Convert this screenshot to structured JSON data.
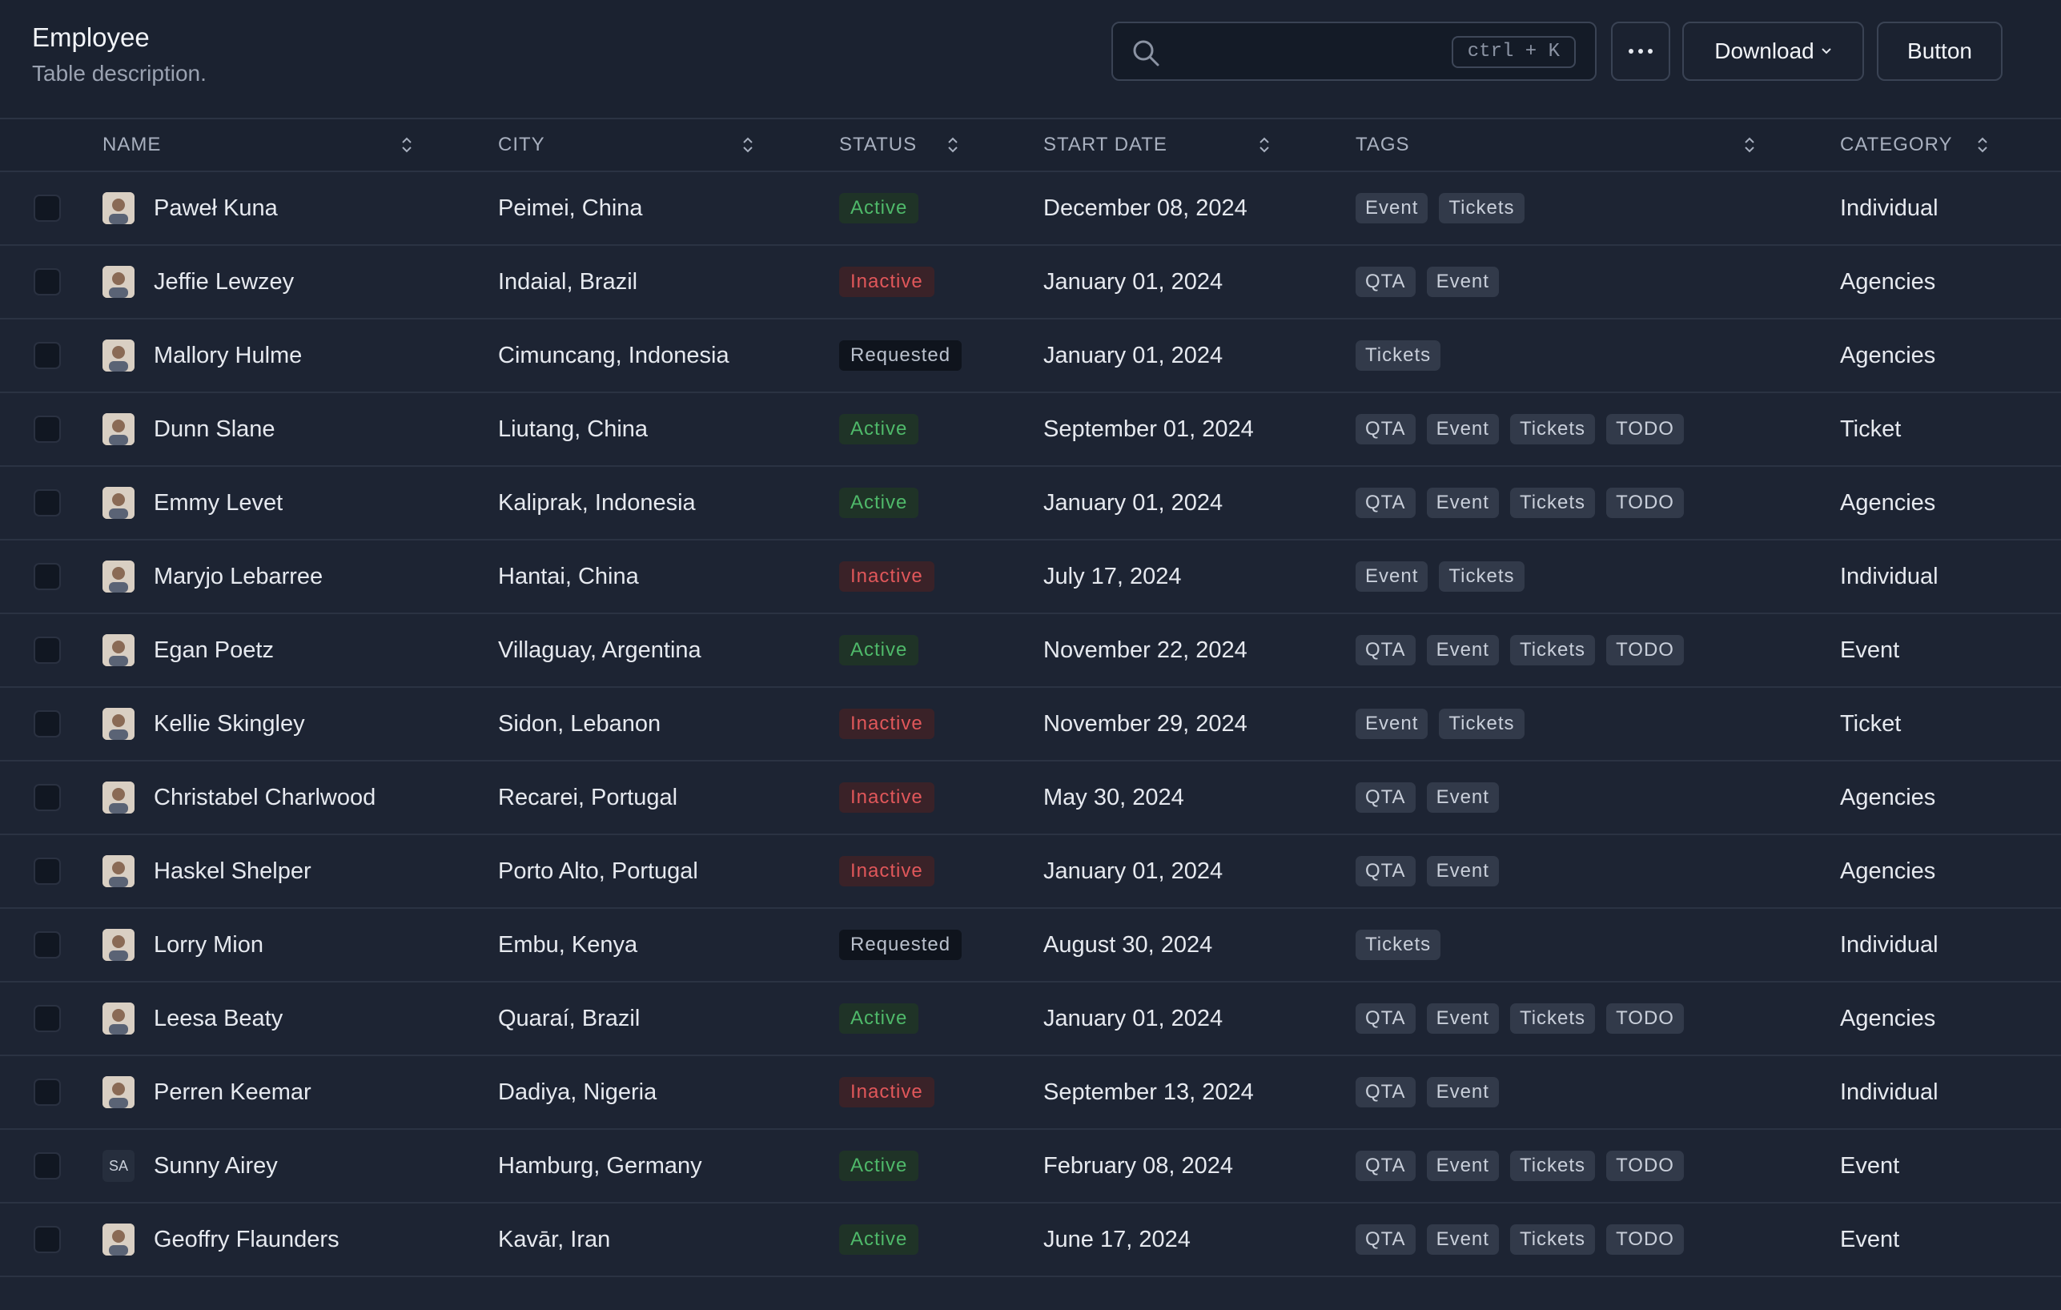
{
  "header": {
    "title": "Employee",
    "subtitle": "Table description.",
    "search_placeholder": "",
    "search_shortcut": "ctrl + K",
    "more_icon": "ellipsis-icon",
    "download_label": "Download",
    "button_label": "Button"
  },
  "columns": [
    "NAME",
    "CITY",
    "STATUS",
    "START DATE",
    "TAGS",
    "CATEGORY"
  ],
  "rows": [
    {
      "name": "Paweł Kuna",
      "avatar": "photo",
      "city": "Peimei, China",
      "status": "Active",
      "start": "December 08, 2024",
      "tags": [
        "Event",
        "Tickets"
      ],
      "category": "Individual"
    },
    {
      "name": "Jeffie Lewzey",
      "avatar": "photo",
      "city": "Indaial, Brazil",
      "status": "Inactive",
      "start": "January 01, 2024",
      "tags": [
        "QTA",
        "Event"
      ],
      "category": "Agencies"
    },
    {
      "name": "Mallory Hulme",
      "avatar": "photo",
      "city": "Cimuncang, Indonesia",
      "status": "Requested",
      "start": "January 01, 2024",
      "tags": [
        "Tickets"
      ],
      "category": "Agencies"
    },
    {
      "name": "Dunn Slane",
      "avatar": "photo",
      "city": "Liutang, China",
      "status": "Active",
      "start": "September 01, 2024",
      "tags": [
        "QTA",
        "Event",
        "Tickets",
        "TODO"
      ],
      "category": "Ticket"
    },
    {
      "name": "Emmy Levet",
      "avatar": "photo",
      "city": "Kaliprak, Indonesia",
      "status": "Active",
      "start": "January 01, 2024",
      "tags": [
        "QTA",
        "Event",
        "Tickets",
        "TODO"
      ],
      "category": "Agencies"
    },
    {
      "name": "Maryjo Lebarree",
      "avatar": "photo",
      "city": "Hantai, China",
      "status": "Inactive",
      "start": "July 17, 2024",
      "tags": [
        "Event",
        "Tickets"
      ],
      "category": "Individual"
    },
    {
      "name": "Egan Poetz",
      "avatar": "photo",
      "city": "Villaguay, Argentina",
      "status": "Active",
      "start": "November 22, 2024",
      "tags": [
        "QTA",
        "Event",
        "Tickets",
        "TODO"
      ],
      "category": "Event"
    },
    {
      "name": "Kellie Skingley",
      "avatar": "photo",
      "city": "Sidon, Lebanon",
      "status": "Inactive",
      "start": "November 29, 2024",
      "tags": [
        "Event",
        "Tickets"
      ],
      "category": "Ticket"
    },
    {
      "name": "Christabel Charlwood",
      "avatar": "photo",
      "city": "Recarei, Portugal",
      "status": "Inactive",
      "start": "May 30, 2024",
      "tags": [
        "QTA",
        "Event"
      ],
      "category": "Agencies"
    },
    {
      "name": "Haskel Shelper",
      "avatar": "photo",
      "city": "Porto Alto, Portugal",
      "status": "Inactive",
      "start": "January 01, 2024",
      "tags": [
        "QTA",
        "Event"
      ],
      "category": "Agencies"
    },
    {
      "name": "Lorry Mion",
      "avatar": "photo",
      "city": "Embu, Kenya",
      "status": "Requested",
      "start": "August 30, 2024",
      "tags": [
        "Tickets"
      ],
      "category": "Individual"
    },
    {
      "name": "Leesa Beaty",
      "avatar": "photo",
      "city": "Quaraí, Brazil",
      "status": "Active",
      "start": "January 01, 2024",
      "tags": [
        "QTA",
        "Event",
        "Tickets",
        "TODO"
      ],
      "category": "Agencies"
    },
    {
      "name": "Perren Keemar",
      "avatar": "photo",
      "city": "Dadiya, Nigeria",
      "status": "Inactive",
      "start": "September 13, 2024",
      "tags": [
        "QTA",
        "Event"
      ],
      "category": "Individual"
    },
    {
      "name": "Sunny Airey",
      "avatar": "SA",
      "city": "Hamburg, Germany",
      "status": "Active",
      "start": "February 08, 2024",
      "tags": [
        "QTA",
        "Event",
        "Tickets",
        "TODO"
      ],
      "category": "Event"
    },
    {
      "name": "Geoffry Flaunders",
      "avatar": "photo",
      "city": "Kavār, Iran",
      "status": "Active",
      "start": "June 17, 2024",
      "tags": [
        "QTA",
        "Event",
        "Tickets",
        "TODO"
      ],
      "category": "Event"
    }
  ],
  "colors": {
    "background": "#1d2433",
    "active": "#4fb96a",
    "inactive": "#e0575a"
  }
}
